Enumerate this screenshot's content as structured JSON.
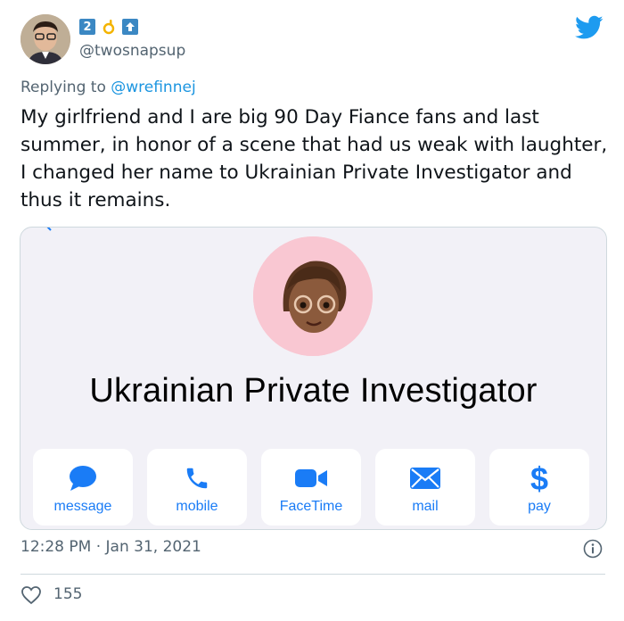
{
  "author": {
    "handle": "@twosnapsup",
    "badges": [
      "2",
      "ok-hand-emoji",
      "up-arrow-emoji"
    ]
  },
  "reply": {
    "prefix": "Replying to ",
    "mention": "@wrefinnej"
  },
  "tweet": {
    "text": "My girlfriend and I are big 90 Day Fiance fans and last summer, in honor of a scene that had us weak with laughter, I changed her name to Ukrainian Private Investigator and thus it remains."
  },
  "contact_card": {
    "name": "Ukrainian Private Investigator",
    "actions": [
      {
        "label": "message",
        "icon": "message-bubble-icon"
      },
      {
        "label": "mobile",
        "icon": "phone-icon"
      },
      {
        "label": "FaceTime",
        "icon": "video-camera-icon"
      },
      {
        "label": "mail",
        "icon": "envelope-icon"
      },
      {
        "label": "pay",
        "icon": "dollar-icon"
      }
    ],
    "accent_color": "#1a7cf6",
    "avatar_bg_color": "#f9c7d2"
  },
  "meta": {
    "timestamp": "12:28 PM · Jan 31, 2021",
    "like_count": "155"
  },
  "colors": {
    "twitter_blue": "#1d9bf0",
    "secondary_text": "#536471",
    "badge_blue": "#3b88c3"
  }
}
